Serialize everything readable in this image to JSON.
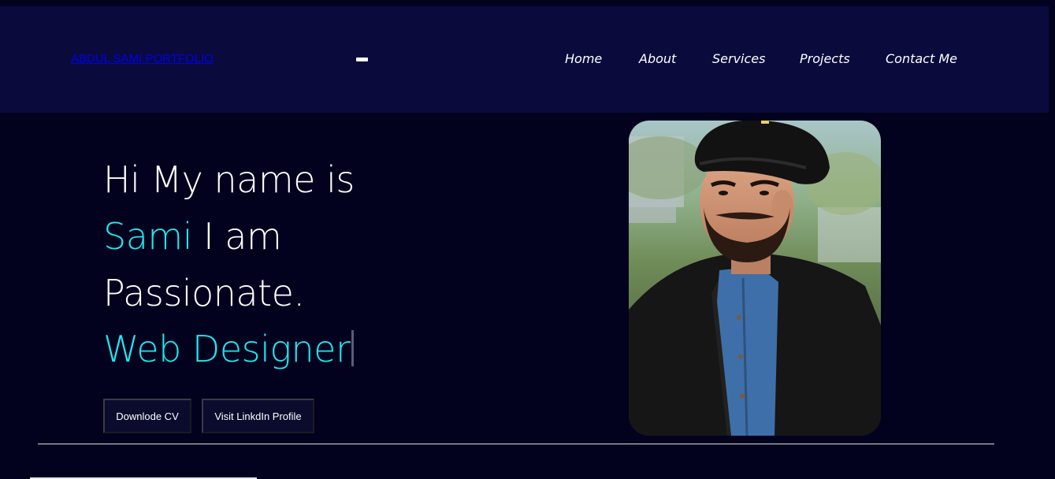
{
  "header": {
    "brand": "ABDUL SAMI PORTFOLIO",
    "nav": [
      {
        "label": "Home"
      },
      {
        "label": "About"
      },
      {
        "label": "Services"
      },
      {
        "label": "Projects"
      },
      {
        "label": "Contact Me"
      }
    ]
  },
  "hero": {
    "line1": "Hi My name is",
    "name": "Sami",
    "line2_rest": " I am",
    "line3": "Passionate.",
    "role": "Web Designer",
    "buttons": {
      "cv": "Downlode CV",
      "linkedin": "Visit LinkdIn Profile"
    }
  },
  "colors": {
    "accent": "#1ee8ee",
    "navbar": "#0a0a3d",
    "background": "#02021e"
  },
  "icons": {
    "menu": "menu-toggle-icon",
    "photo": "profile-photo"
  }
}
